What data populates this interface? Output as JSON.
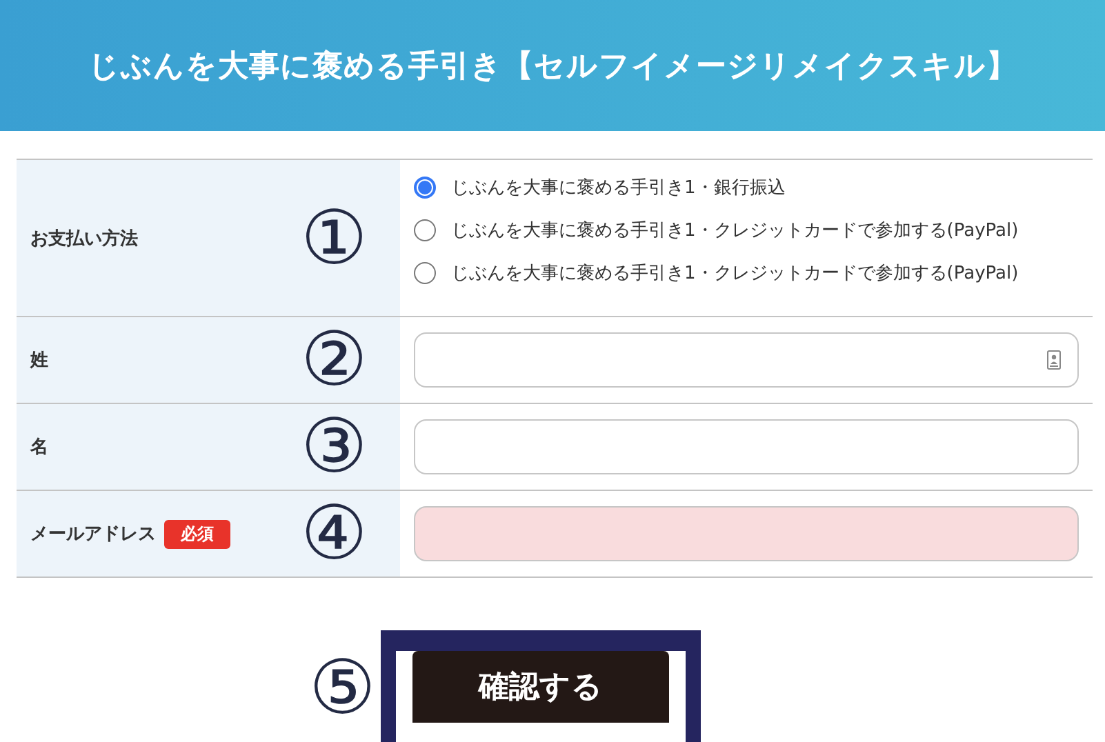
{
  "header": {
    "title": "じぶんを大事に褒める手引き【セルフイメージリメイクスキル】"
  },
  "rows": [
    {
      "kind": "radio",
      "label": "お支払い方法",
      "marker": "①",
      "options": [
        {
          "label": "じぶんを大事に褒める手引き1・銀行振込",
          "selected": true
        },
        {
          "label": "じぶんを大事に褒める手引き1・クレジットカードで参加する(PayPal)",
          "selected": false
        },
        {
          "label": "じぶんを大事に褒める手引き1・クレジットカードで参加する(PayPal)",
          "selected": false
        }
      ]
    },
    {
      "kind": "text",
      "label": "姓",
      "marker": "②",
      "contact_icon": true,
      "invalid": false
    },
    {
      "kind": "text",
      "label": "名",
      "marker": "③",
      "invalid": false
    },
    {
      "kind": "text",
      "label": "メールアドレス",
      "marker": "④",
      "badge": "必須",
      "invalid": true
    }
  ],
  "submit": {
    "marker": "⑤",
    "label": "確認する"
  }
}
